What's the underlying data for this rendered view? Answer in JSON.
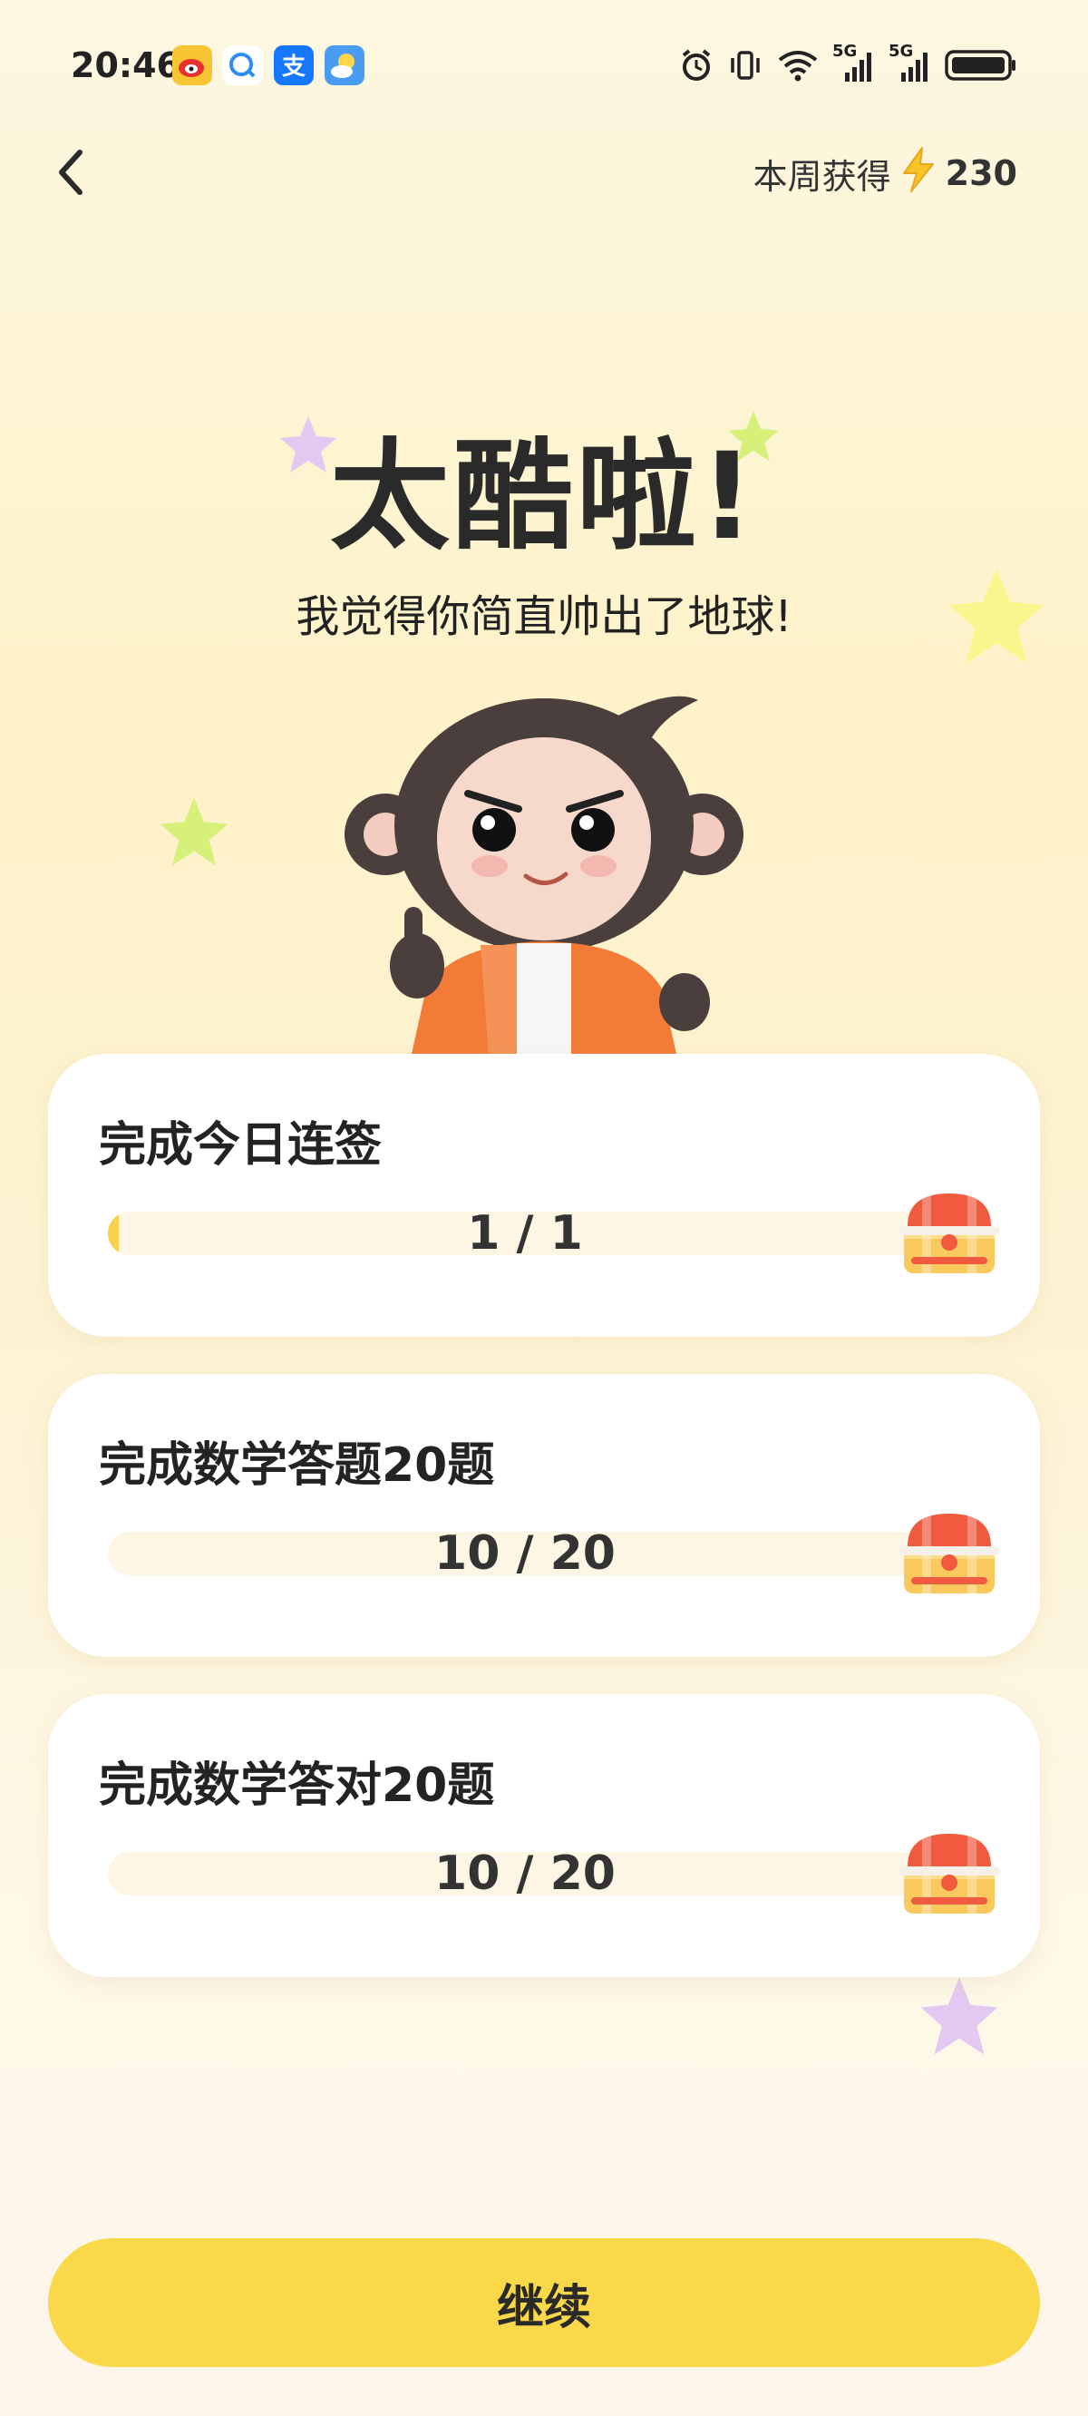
{
  "status_bar": {
    "time": "20:46",
    "apps": [
      "weibo-icon",
      "message-icon",
      "alipay-icon",
      "weather-icon"
    ],
    "icons": [
      "alarm-icon",
      "vibrate-icon",
      "wifi-icon",
      "5g-signal-icon",
      "5g-signal-icon",
      "battery-icon"
    ],
    "network_label_1": "5G",
    "network_label_2": "5G"
  },
  "header": {
    "weekly_label": "本周获得",
    "weekly_icon": "lightning-icon",
    "weekly_value": "230"
  },
  "hero": {
    "title": "太酷啦!",
    "subtitle": "我觉得你简直帅出了地球!"
  },
  "tasks": [
    {
      "title": "完成今日连签",
      "progress_text": "1 / 1",
      "current": 1,
      "total": 1,
      "reward_icon": "treasure-chest-icon"
    },
    {
      "title": "完成数学答题20题",
      "progress_text": "10 / 20",
      "current": 10,
      "total": 20,
      "reward_icon": "treasure-chest-icon"
    },
    {
      "title": "完成数学答对20题",
      "progress_text": "10 / 20",
      "current": 10,
      "total": 20,
      "reward_icon": "treasure-chest-icon"
    }
  ],
  "actions": {
    "continue_label": "继续"
  },
  "colors": {
    "accent": "#f9d84a",
    "fill": "#f8d24c",
    "track": "#fdf6e4",
    "star_purple": "#e3c9f2",
    "star_green": "#d7f07a",
    "star_yellow": "#fbf58e"
  }
}
